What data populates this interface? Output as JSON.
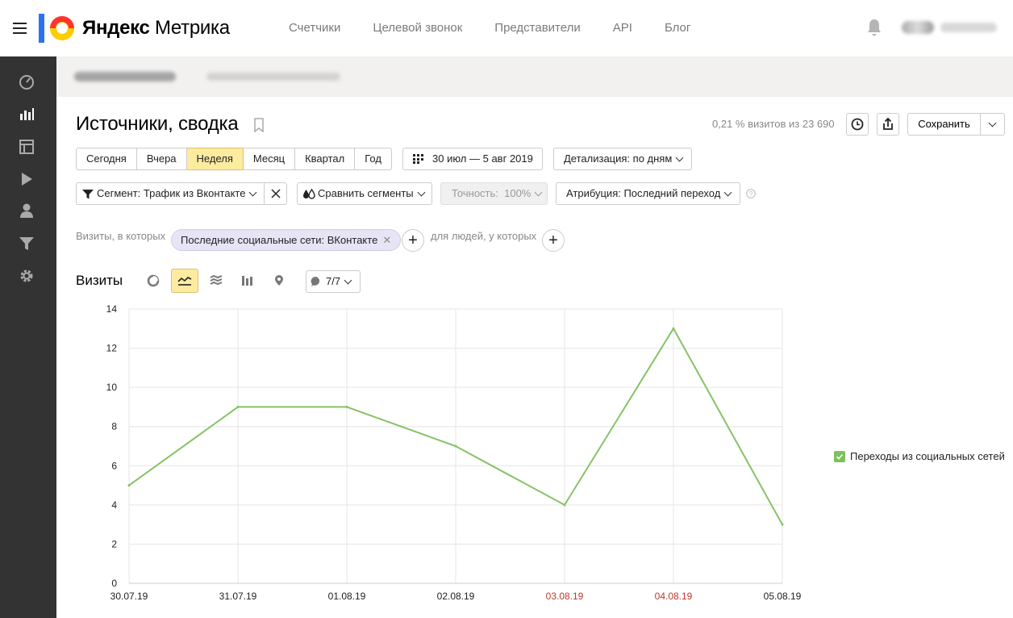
{
  "header": {
    "logo_text_bold": "Яндекс",
    "logo_text": "Метрика",
    "nav": [
      "Счетчики",
      "Целевой звонок",
      "Представители",
      "API",
      "Блог"
    ]
  },
  "page": {
    "title": "Источники, сводка",
    "visits_info": "0,21 % визитов из 23 690",
    "save_label": "Сохранить"
  },
  "period": {
    "options": [
      "Сегодня",
      "Вчера",
      "Неделя",
      "Месяц",
      "Квартал",
      "Год"
    ],
    "active": "Неделя",
    "date_range": "30 июл — 5 авг 2019",
    "detail": "Детализация: по дням"
  },
  "filters": {
    "segment": "Сегмент: Трафик из Вконтакте",
    "compare": "Сравнить сегменты",
    "accuracy": "Точность:  100%",
    "attribution": "Атрибуция: Последний переход",
    "visits_where": "Визиты, в которых",
    "condition_chip": "Последние социальные сети: ВКонтакте",
    "people_where": "для людей, у которых"
  },
  "chart_panel": {
    "title": "Визиты",
    "metrics_counter": "7/7",
    "legend": "Переходы из социальных сетей"
  },
  "colors": {
    "line": "#86c267",
    "weekend": "#c0392b",
    "active_bg": "#fdeba0",
    "rail": "#333333",
    "accent_yellow": "#ffcc00",
    "accent_blue": "#2b72f3",
    "accent_red": "#f33"
  },
  "chart_data": {
    "type": "line",
    "categories": [
      "30.07.19",
      "31.07.19",
      "01.08.19",
      "02.08.19",
      "03.08.19",
      "04.08.19",
      "05.08.19"
    ],
    "weekend_categories": [
      "03.08.19",
      "04.08.19"
    ],
    "series": [
      {
        "name": "Переходы из социальных сетей",
        "values": [
          5,
          9,
          9,
          7,
          4,
          13,
          3
        ]
      }
    ],
    "ylim": [
      0,
      14
    ],
    "yticks": [
      0,
      2,
      4,
      6,
      8,
      10,
      12,
      14
    ],
    "grid": true,
    "legend_position": "right"
  }
}
